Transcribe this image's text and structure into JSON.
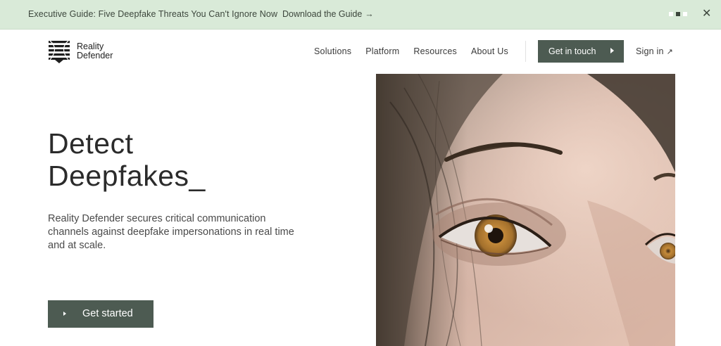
{
  "banner": {
    "text": "Executive Guide: Five Deepfake Threats You Can't Ignore Now",
    "link_label": "Download the Guide",
    "link_arrow": "→",
    "close_glyph": "✕"
  },
  "logo": {
    "line1": "Reality",
    "line2": "Defender"
  },
  "nav": {
    "items": [
      "Solutions",
      "Platform",
      "Resources",
      "About Us"
    ],
    "cta_label": "Get in touch",
    "signin_label": "Sign in",
    "signin_arrow": "↗"
  },
  "hero": {
    "title_line1": "Detect",
    "title_line2": "Deepfakes_",
    "description": "Reality Defender secures critical communication channels against deepfake impersonations in real time and at scale.",
    "cta_label": "Get started"
  },
  "colors": {
    "banner_bg": "#d9ead8",
    "button_bg": "#4d5b52",
    "text": "#2a2a2a"
  },
  "icons": [
    "reality-defender-logo",
    "arrow-right-icon",
    "close-icon",
    "play-caret-icon",
    "external-arrow-icon"
  ]
}
